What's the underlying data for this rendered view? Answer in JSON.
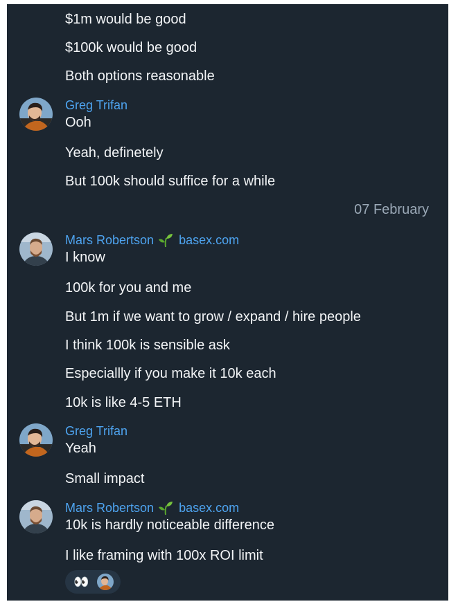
{
  "messages": [
    {
      "text": "$1m would be good"
    },
    {
      "text": "$100k would be good"
    },
    {
      "text": "Both options reasonable"
    },
    {
      "sender": "Greg Trifan",
      "text": "Ooh"
    },
    {
      "text": "Yeah, definetely"
    },
    {
      "text": "But 100k should suffice for a while"
    },
    {
      "sender": "Mars Robertson",
      "org": "basex.com",
      "text": "I know"
    },
    {
      "text": "100k for you and me"
    },
    {
      "text": "But 1m if we want to grow / expand / hire people"
    },
    {
      "text": "I think 100k is sensible ask"
    },
    {
      "text": "Especiallly if you make it 10k each"
    },
    {
      "text": "10k is like 4-5 ETH"
    },
    {
      "sender": "Greg Trifan",
      "text": "Yeah"
    },
    {
      "text": "Small impact"
    },
    {
      "sender": "Mars Robertson",
      "org": "basex.com",
      "text": "10k is hardly noticeable difference"
    },
    {
      "text": "I like framing with 100x ROI limit"
    }
  ],
  "date_separator": "07 February",
  "reaction": {
    "emoji": "👀"
  },
  "colors": {
    "background": "#1c2630",
    "message_text": "#f2f4f6",
    "sender_name": "#4ea4f0",
    "date_text": "#9aa8b6",
    "reaction_bg": "#263544"
  },
  "icons": [
    "user-avatar-greg",
    "user-avatar-mars",
    "sprout-icon",
    "eyes-emoji"
  ]
}
